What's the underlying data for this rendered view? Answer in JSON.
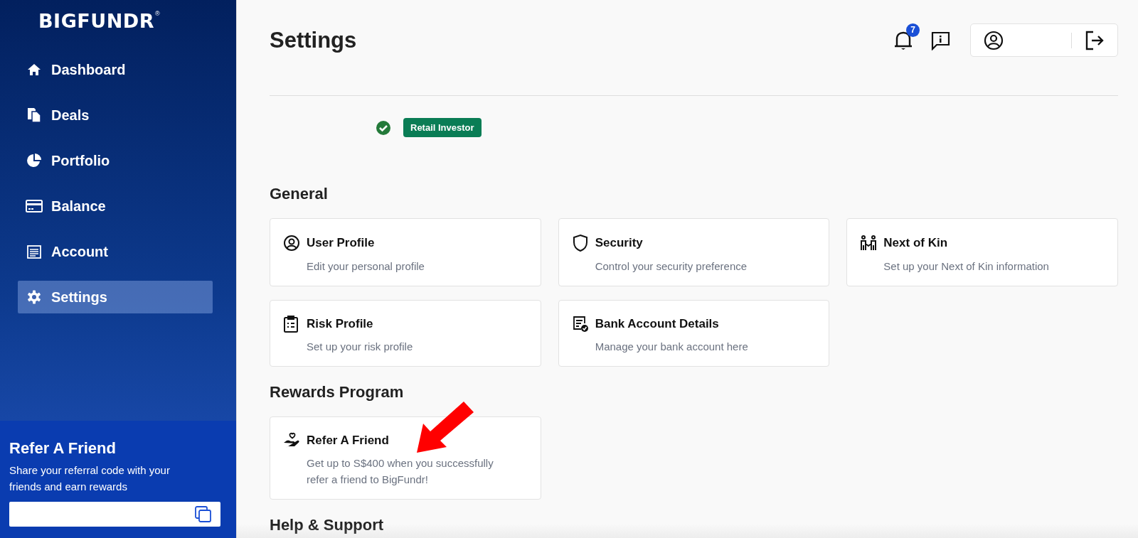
{
  "sidebar": {
    "logo": "BIGFUNDR",
    "logo_mark": "®",
    "items": [
      {
        "label": "Dashboard",
        "kind": "home",
        "selected": false
      },
      {
        "label": "Deals",
        "kind": "deals",
        "selected": false
      },
      {
        "label": "Portfolio",
        "kind": "pie",
        "selected": false
      },
      {
        "label": "Balance",
        "kind": "card",
        "selected": false
      },
      {
        "label": "Account",
        "kind": "account",
        "selected": false
      },
      {
        "label": "Settings",
        "kind": "gear",
        "selected": true
      }
    ],
    "referral": {
      "title": "Refer A Friend",
      "description": "Share your referral code with your friends and earn rewards"
    }
  },
  "header": {
    "title": "Settings",
    "notification_count": "7"
  },
  "investor_badge": "Retail Investor",
  "sections": [
    {
      "title": "General",
      "cards": [
        {
          "kind": "user",
          "title": "User Profile",
          "description": "Edit your personal profile"
        },
        {
          "kind": "shield",
          "title": "Security",
          "description": "Control your security preference"
        },
        {
          "kind": "family",
          "title": "Next of Kin",
          "description": "Set up your Next of Kin information"
        },
        {
          "kind": "clipboard",
          "title": "Risk Profile",
          "description": "Set up your risk profile"
        },
        {
          "kind": "bank",
          "title": "Bank Account Details",
          "description": "Manage your bank account here"
        }
      ]
    },
    {
      "title": "Rewards Program",
      "cards": [
        {
          "kind": "hand-heart",
          "title": "Refer A Friend",
          "description": "Get up to S$400 when you successfully refer a friend to BigFundr!"
        }
      ]
    },
    {
      "title": "Help & Support"
    }
  ]
}
